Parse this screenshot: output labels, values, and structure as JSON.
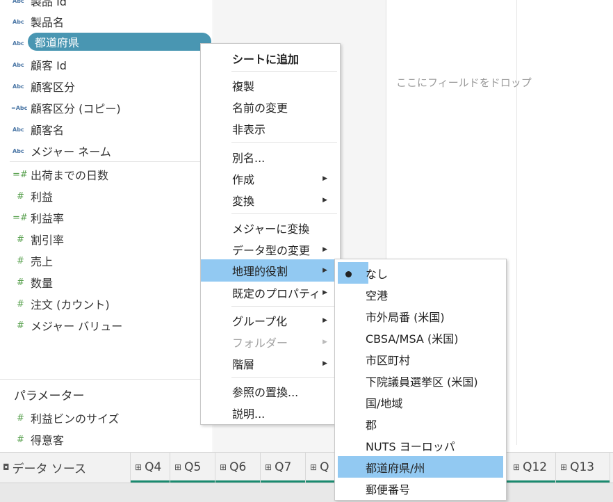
{
  "data_pane": {
    "fields": [
      {
        "icon": "Abc",
        "label": "製品 Id"
      },
      {
        "icon": "Abc",
        "label": "製品名"
      },
      {
        "icon": "Abc",
        "label": "都道府県"
      },
      {
        "icon": "Abc",
        "label": "顧客 Id"
      },
      {
        "icon": "Abc",
        "label": "顧客区分"
      },
      {
        "icon": "=Abc",
        "label": "顧客区分 (コピー)"
      },
      {
        "icon": "Abc",
        "label": "顧客名"
      },
      {
        "icon": "Abc",
        "label": "メジャー ネーム"
      }
    ],
    "measures": [
      {
        "icon": "=#",
        "label": "出荷までの日数"
      },
      {
        "icon": "#",
        "label": "利益"
      },
      {
        "icon": "=#",
        "label": "利益率"
      },
      {
        "icon": "#",
        "label": "割引率"
      },
      {
        "icon": "#",
        "label": "売上"
      },
      {
        "icon": "#",
        "label": "数量"
      },
      {
        "icon": "#",
        "label": "注文 (カウント)"
      },
      {
        "icon": "#",
        "label": "メジャー バリュー"
      }
    ],
    "parameters_title": "パラメーター",
    "parameters": [
      {
        "icon": "#",
        "label": "利益ビンのサイズ"
      },
      {
        "icon": "#",
        "label": "得意客"
      }
    ]
  },
  "canvas": {
    "drop_hint": "ここにフィールドをドロップ"
  },
  "context_menu": {
    "items": [
      {
        "label": "シートに追加"
      },
      {
        "label": "複製"
      },
      {
        "label": "名前の変更"
      },
      {
        "label": "非表示"
      },
      {
        "label": "別名..."
      },
      {
        "label": "作成"
      },
      {
        "label": "変換"
      },
      {
        "label": "メジャーに変換"
      },
      {
        "label": "データ型の変更"
      },
      {
        "label": "地理的役割"
      },
      {
        "label": "既定のプロパティ"
      },
      {
        "label": "グループ化"
      },
      {
        "label": "フォルダー"
      },
      {
        "label": "階層"
      },
      {
        "label": "参照の置換..."
      },
      {
        "label": "説明..."
      }
    ]
  },
  "geo_submenu": {
    "items": [
      {
        "label": "なし",
        "checked": true
      },
      {
        "label": "空港"
      },
      {
        "label": "市外局番 (米国)"
      },
      {
        "label": "CBSA/MSA (米国)"
      },
      {
        "label": "市区町村"
      },
      {
        "label": "下院議員選挙区 (米国)"
      },
      {
        "label": "国/地域"
      },
      {
        "label": "郡"
      },
      {
        "label": "NUTS ヨーロッパ"
      },
      {
        "label": "都道府県/州"
      },
      {
        "label": "郵便番号"
      }
    ]
  },
  "tabs": {
    "data_source": "データ ソース",
    "sheets": [
      "Q4",
      "Q5",
      "Q6",
      "Q7",
      "Q",
      "Q12",
      "Q13"
    ]
  },
  "colors": {
    "selected_field": "#4996b2",
    "menu_highlight": "#92c9f2",
    "dimension_icon": "#4e79a7",
    "measure_icon": "#59a14f",
    "tab_accent": "#1a8a6f"
  }
}
